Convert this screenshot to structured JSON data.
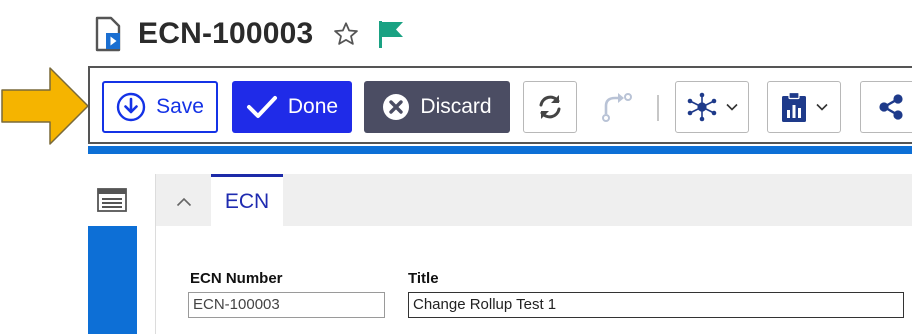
{
  "header": {
    "title": "ECN-100003",
    "icons": {
      "document": "document-play-icon",
      "favorite": "star-outline-icon",
      "flag": "flag-icon"
    },
    "flag_color": "#1aa283"
  },
  "callout": {
    "icon": "right-arrow-pointer",
    "color": "#f5b400"
  },
  "toolbar": {
    "save_label": "Save",
    "done_label": "Done",
    "discard_label": "Discard",
    "icons": [
      "refresh-icon",
      "route-icon",
      "network-icon",
      "report-icon",
      "share-icon"
    ],
    "colors": {
      "save": "#1432e6",
      "done": "#1f2be8",
      "discard": "#4b4d63",
      "accent_bar": "#0d6fd6"
    }
  },
  "sidebar": {
    "icon": "form-view-icon"
  },
  "form": {
    "tab_label": "ECN",
    "ecn_number_label": "ECN Number",
    "ecn_number_value": "ECN-100003",
    "title_label": "Title",
    "title_value": "Change Rollup Test 1"
  }
}
